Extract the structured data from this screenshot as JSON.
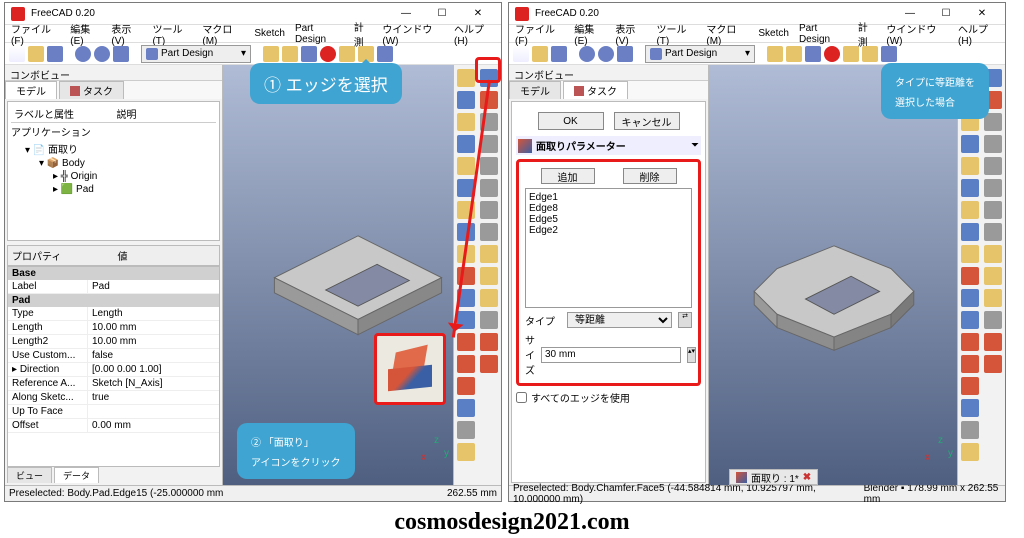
{
  "app_title": "FreeCAD 0.20",
  "menus": [
    "ファイル(F)",
    "編集(E)",
    "表示(V)",
    "ツール(T)",
    "マクロ(M)",
    "Sketch",
    "Part Design",
    "計測",
    "ウインドウ(W)",
    "ヘルプ(H)"
  ],
  "workbench_selector": "Part Design",
  "combo_view_title": "コンボビュー",
  "tabs": {
    "model": "モデル",
    "task": "タスク"
  },
  "tree": {
    "labels_header": "ラベルと属性",
    "desc_header": "説明",
    "application": "アプリケーション",
    "doc": "面取り",
    "body": "Body",
    "origin": "Origin",
    "pad": "Pad"
  },
  "props": {
    "header_prop": "プロパティ",
    "header_val": "値",
    "sections": {
      "base": "Base",
      "pad": "Pad"
    },
    "rows": [
      {
        "k": "Label",
        "v": "Pad"
      },
      {
        "k": "Type",
        "v": "Length"
      },
      {
        "k": "Length",
        "v": "10.00 mm"
      },
      {
        "k": "Length2",
        "v": "10.00 mm"
      },
      {
        "k": "Use Custom...",
        "v": "false"
      },
      {
        "k": "Direction",
        "v": "[0.00 0.00 1.00]"
      },
      {
        "k": "Reference A...",
        "v": "Sketch [N_Axis]"
      },
      {
        "k": "Along Sketc...",
        "v": "true"
      },
      {
        "k": "Up To Face",
        "v": ""
      },
      {
        "k": "Offset",
        "v": "0.00 mm"
      }
    ],
    "bottom_tabs": {
      "view": "ビュー",
      "data": "データ"
    }
  },
  "callouts": {
    "c1": "① エッジを選択",
    "c2a": "② 「面取り」",
    "c2b": "アイコンをクリック",
    "c3a": "タイプに等距離を",
    "c3b": "選択した場合"
  },
  "status": {
    "left_a": "Preselected:        Body.Pad.Edge15 (-25.000000 mm",
    "left_b": "262.55 mm",
    "right_a": "Preselected:        Body.Chamfer.Face5 (-44.584814 mm, 10.925797 mm, 10.000000 mm)",
    "right_b": "Blender ▪  178.99 mm x 262.55 mm"
  },
  "task": {
    "ok": "OK",
    "cancel": "キャンセル",
    "panel_title": "面取りパラメーター",
    "add": "追加",
    "remove": "削除",
    "edges": [
      "Edge1",
      "Edge8",
      "Edge5",
      "Edge2"
    ],
    "type_label": "タイプ",
    "type_value": "等距離",
    "size_label": "サイズ",
    "size_value": "30 mm",
    "use_all": "すべてのエッジを使用"
  },
  "tab3d": {
    "label": "面取り : 1*"
  },
  "watermark": "cosmosdesign2021.com"
}
